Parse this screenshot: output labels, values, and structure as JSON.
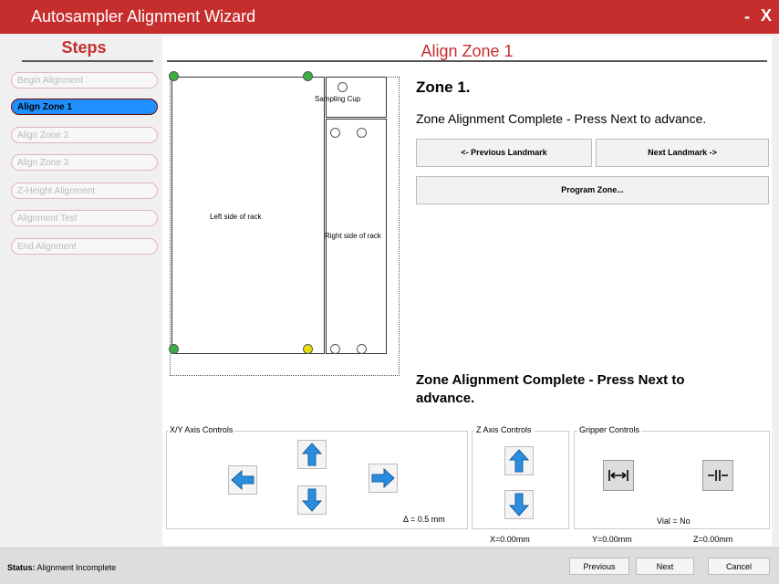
{
  "window": {
    "title": "Autosampler Alignment Wizard",
    "minimize": "-",
    "close": "X"
  },
  "sidebar": {
    "heading": "Steps",
    "items": [
      {
        "label": "Begin Alignment"
      },
      {
        "label": "Align Zone 1",
        "active": true
      },
      {
        "label": "Align Zone 2"
      },
      {
        "label": "Align Zone 3"
      },
      {
        "label": "Z-Height Alignment"
      },
      {
        "label": "Alignment Test"
      },
      {
        "label": "End Alignment"
      }
    ]
  },
  "main": {
    "heading": "Align Zone 1",
    "zone_title": "Zone 1.",
    "zone_message": "Zone Alignment Complete - Press Next to advance.",
    "prev_landmark": "<- Previous Landmark",
    "next_landmark": "Next Landmark ->",
    "program_zone": "Program Zone...",
    "zone_message_bottom": "Zone Alignment Complete - Press Next to advance."
  },
  "rack": {
    "left_label": "Left side of rack",
    "right_label": "Right side of rack",
    "cup_label": "Sampling Cup"
  },
  "controls": {
    "xy_title": "X/Y Axis Controls",
    "z_title": "Z Axis Controls",
    "gripper_title": "Gripper Controls",
    "delta": "Δ = 0.5 mm",
    "vial": "Vial = No"
  },
  "coords": {
    "x": "X=0.00mm",
    "y": "Y=0.00mm",
    "z": "Z=0.00mm"
  },
  "status": {
    "label": "Status:",
    "value": "Alignment Incomplete"
  },
  "nav": {
    "previous": "Previous",
    "next": "Next",
    "cancel": "Cancel"
  },
  "colors": {
    "accent": "#c62e2e",
    "active_step": "#1e90ff",
    "landmark_green": "#3cb043",
    "landmark_yellow": "#e8e000",
    "arrow_blue": "#2a8de0"
  }
}
